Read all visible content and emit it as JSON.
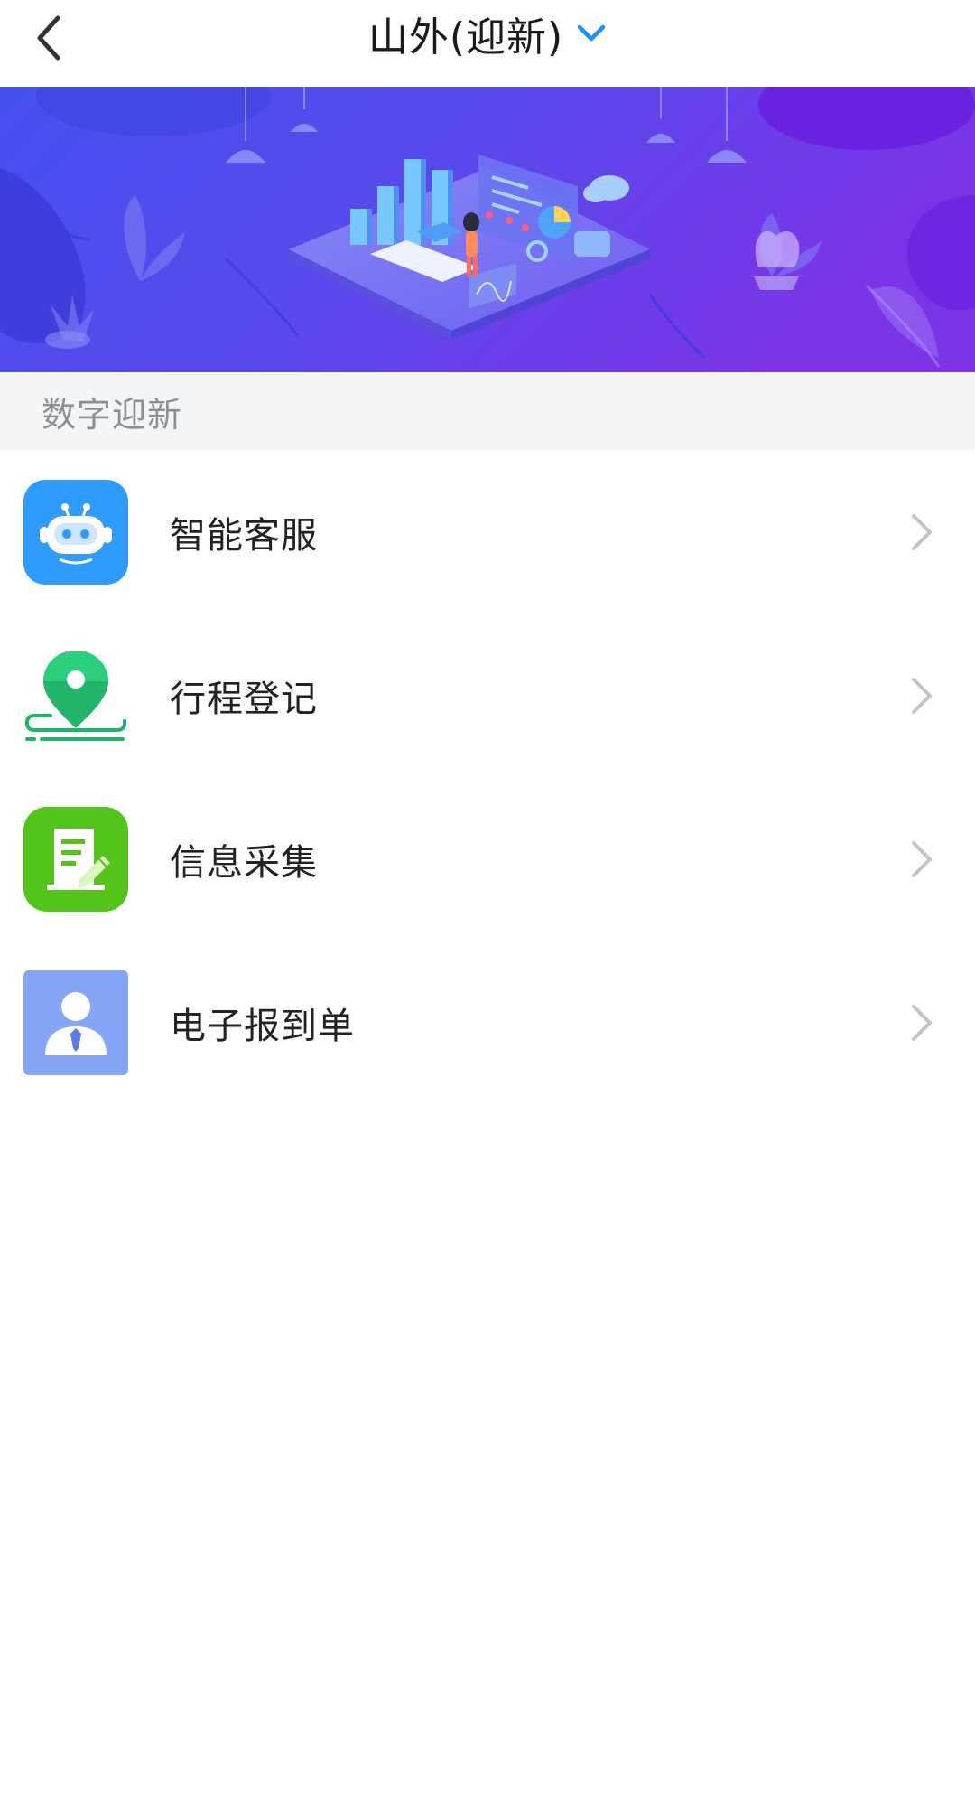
{
  "header": {
    "title": "山外(迎新)",
    "back_icon": "chevron-left-icon",
    "dropdown_icon": "chevron-down-icon",
    "accent_color": "#1e8fff"
  },
  "banner": {
    "gradient_start": "#4a58f0",
    "gradient_end": "#7a35e8"
  },
  "section": {
    "title": "数字迎新"
  },
  "items": [
    {
      "label": "智能客服",
      "icon": "robot-icon",
      "color": "#2f9bff"
    },
    {
      "label": "行程登记",
      "icon": "location-pin-icon",
      "color": "#22b56a"
    },
    {
      "label": "信息采集",
      "icon": "document-edit-icon",
      "color": "#52c41a"
    },
    {
      "label": "电子报到单",
      "icon": "person-badge-icon",
      "color": "#85a5f5"
    }
  ]
}
